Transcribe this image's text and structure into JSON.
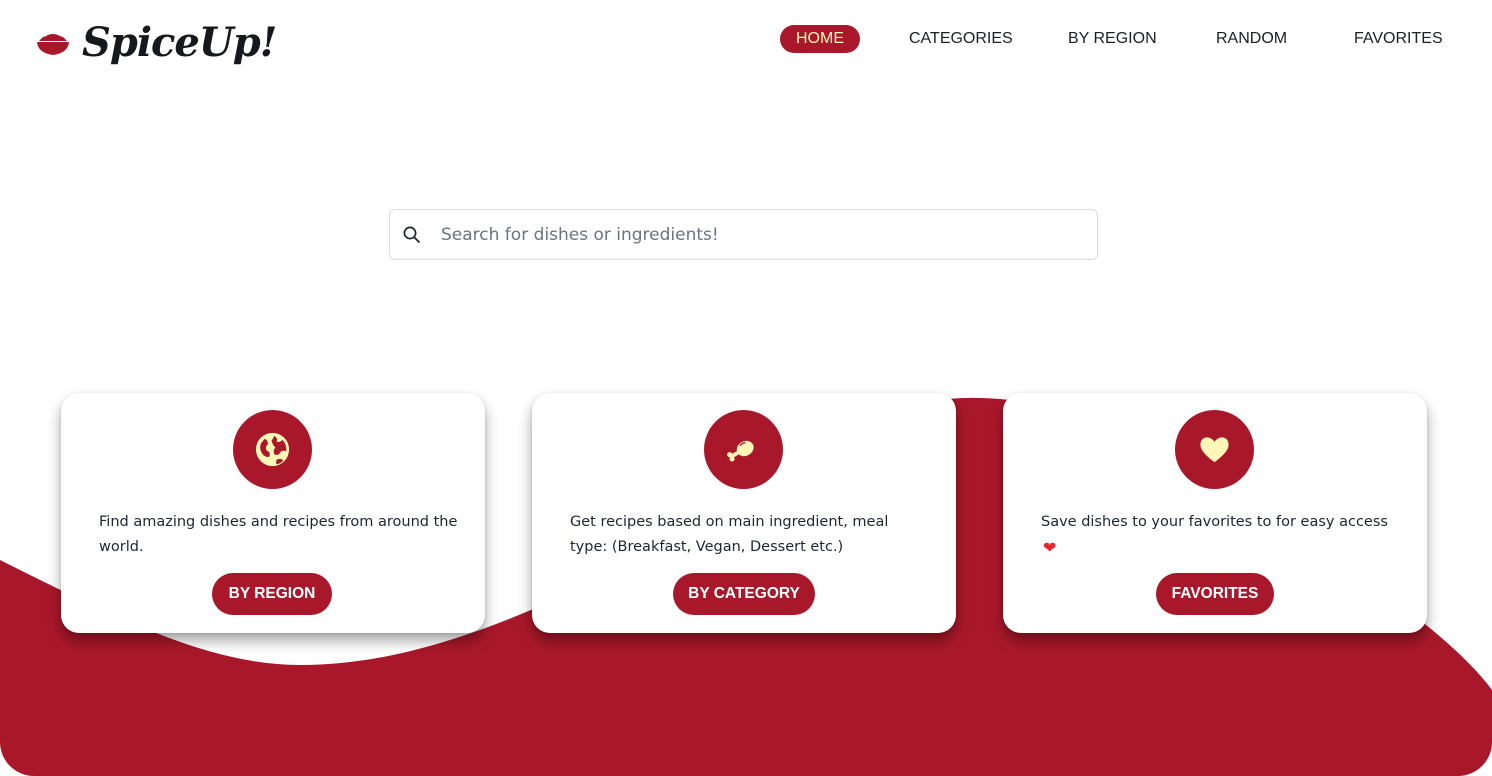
{
  "brand": {
    "name": "SpiceUp!",
    "logo_icon": "bowl-icon"
  },
  "nav": {
    "items": [
      {
        "label": "HOME",
        "active": true
      },
      {
        "label": "CATEGORIES",
        "active": false
      },
      {
        "label": "BY REGION",
        "active": false
      },
      {
        "label": "RANDOM",
        "active": false
      },
      {
        "label": "FAVORITES",
        "active": false
      }
    ]
  },
  "search": {
    "placeholder": "Search for dishes or ingredients!",
    "value": "",
    "icon": "search-icon"
  },
  "cards": [
    {
      "icon": "globe-icon",
      "text": "Find amazing dishes and recipes from around the world.",
      "button": "BY REGION"
    },
    {
      "icon": "meat-icon",
      "text": "Get recipes based on main ingredient, meal type: (Breakfast, Vegan, Dessert etc.)",
      "button": "BY CATEGORY"
    },
    {
      "icon": "heart-icon",
      "text": "Save dishes to your favorites to for easy access",
      "text_emoji": "❤",
      "button": "FAVORITES"
    }
  ],
  "colors": {
    "brand_red": "#a9182a",
    "accent_yellow": "#fff6b8",
    "background": "#ffffff",
    "text": "#1f2530"
  }
}
